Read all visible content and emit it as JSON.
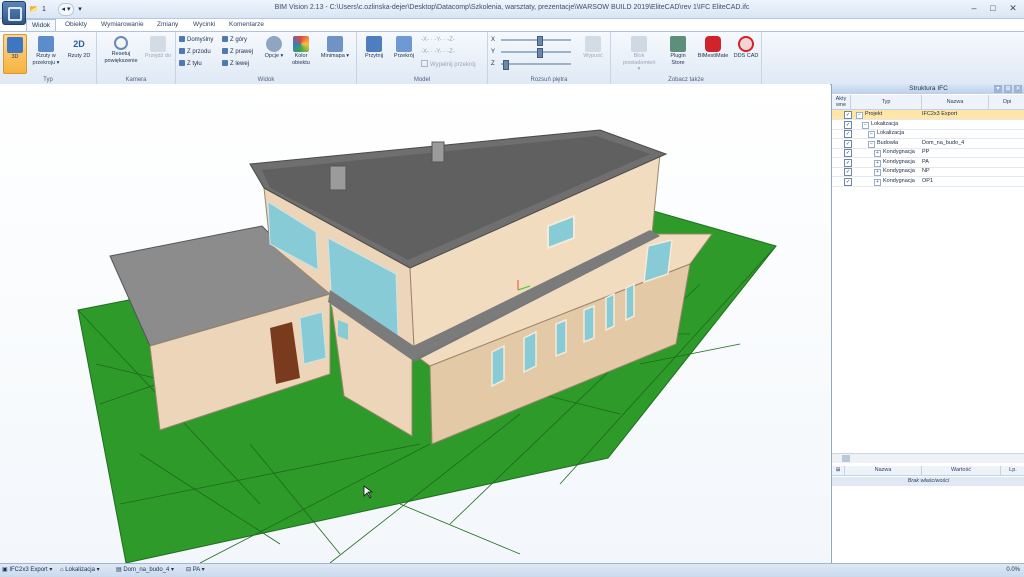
{
  "window": {
    "title": "BIM Vision 2.13 - C:\\Users\\c.ozlinska-dejer\\Desktop\\Datacomp\\Szkolenia, warsztaty, prezentacje\\WARSOW BUILD 2019\\EliteCAD\\rev 1\\IFC EliteCAD.ifc",
    "minimize": "–",
    "maximize": "□",
    "close": "✕"
  },
  "quick_access": {
    "folder": "📂",
    "one": "1",
    "arrow": "▾"
  },
  "tabs": [
    "Widok",
    "Obiekty",
    "Wymiarowanie",
    "Zmiany",
    "Wycinki",
    "Komentarze"
  ],
  "ribbon": {
    "typ": {
      "label": "Typ",
      "b3d": "3D",
      "rzuty": "Rzuty w przekroju ▾",
      "rzuty2d": "Rzuty 2D"
    },
    "kamera": {
      "label": "Kamera",
      "reset": "Resetuj powiększenie",
      "przejdz": "Przejdź do"
    },
    "widok": {
      "label": "Widok",
      "small": [
        "Domyślny",
        "Z przodu",
        "Z tyłu",
        "Z góry",
        "Z prawej",
        "Z lewej"
      ],
      "opcje": "Opcje ▾",
      "kolor": "Kolor obiektu",
      "minimapa": "Minimapa ▾"
    },
    "model": {
      "label": "Model",
      "przytnij": "Przytnij",
      "przekroj": "Przekrój",
      "wypelnij": "Wypełnij przekrój"
    },
    "rozsun": {
      "label": "Rozsuń piętra",
      "x": "X",
      "y": "Y",
      "z": "Z",
      "wypusc": "Wypuść"
    },
    "zobacz": {
      "label": "Zobacz także",
      "blok": "Blok powiadomień ▾",
      "plugin": "Plugin Store",
      "bimestimate": "BIMestiMate",
      "dds": "DDS CAD"
    }
  },
  "panel": {
    "title": "Struktura IFC",
    "columns": {
      "aktywny": "Akty wne",
      "typ": "Typ",
      "nazwa": "Nazwa",
      "opis": "Opi"
    },
    "rows": [
      {
        "typ": "Projekt",
        "nazwa": "IFC2x3 Export",
        "level": 0,
        "exp": "−",
        "sel": true
      },
      {
        "typ": "Lokalizacja",
        "nazwa": "",
        "level": 1,
        "exp": "−",
        "sel": false
      },
      {
        "typ": "Lokalizacja",
        "nazwa": "",
        "level": 2,
        "exp": "−",
        "sel": false
      },
      {
        "typ": "Budowla",
        "nazwa": "Dom_na_budo_4",
        "level": 2,
        "exp": "−",
        "sel": false
      },
      {
        "typ": "Kondygnacja",
        "nazwa": "PP",
        "level": 3,
        "exp": "+",
        "sel": false
      },
      {
        "typ": "Kondygnacja",
        "nazwa": "PA",
        "level": 3,
        "exp": "+",
        "sel": false
      },
      {
        "typ": "Kondygnacja",
        "nazwa": "NP",
        "level": 3,
        "exp": "+",
        "sel": false
      },
      {
        "typ": "Kondygnacja",
        "nazwa": "OP1",
        "level": 3,
        "exp": "+",
        "sel": false
      }
    ],
    "props": {
      "nazwa": "Nazwa",
      "wartosc": "Wartość",
      "lp": "Lp.",
      "empty": "Brak właściwości"
    }
  },
  "statusbar": {
    "crumbs": [
      "IFC2x3 Export",
      "Lokalizacja",
      "Dom_na_budo_4",
      "PA"
    ],
    "zoom": "0.0%"
  },
  "colors": {
    "ground": "#2e9a2a",
    "wall": "#f1dcc0",
    "roof": "#7a7a7a",
    "glass": "#86cbd6",
    "door": "#7a3a1e",
    "accent": "#f6b340"
  }
}
